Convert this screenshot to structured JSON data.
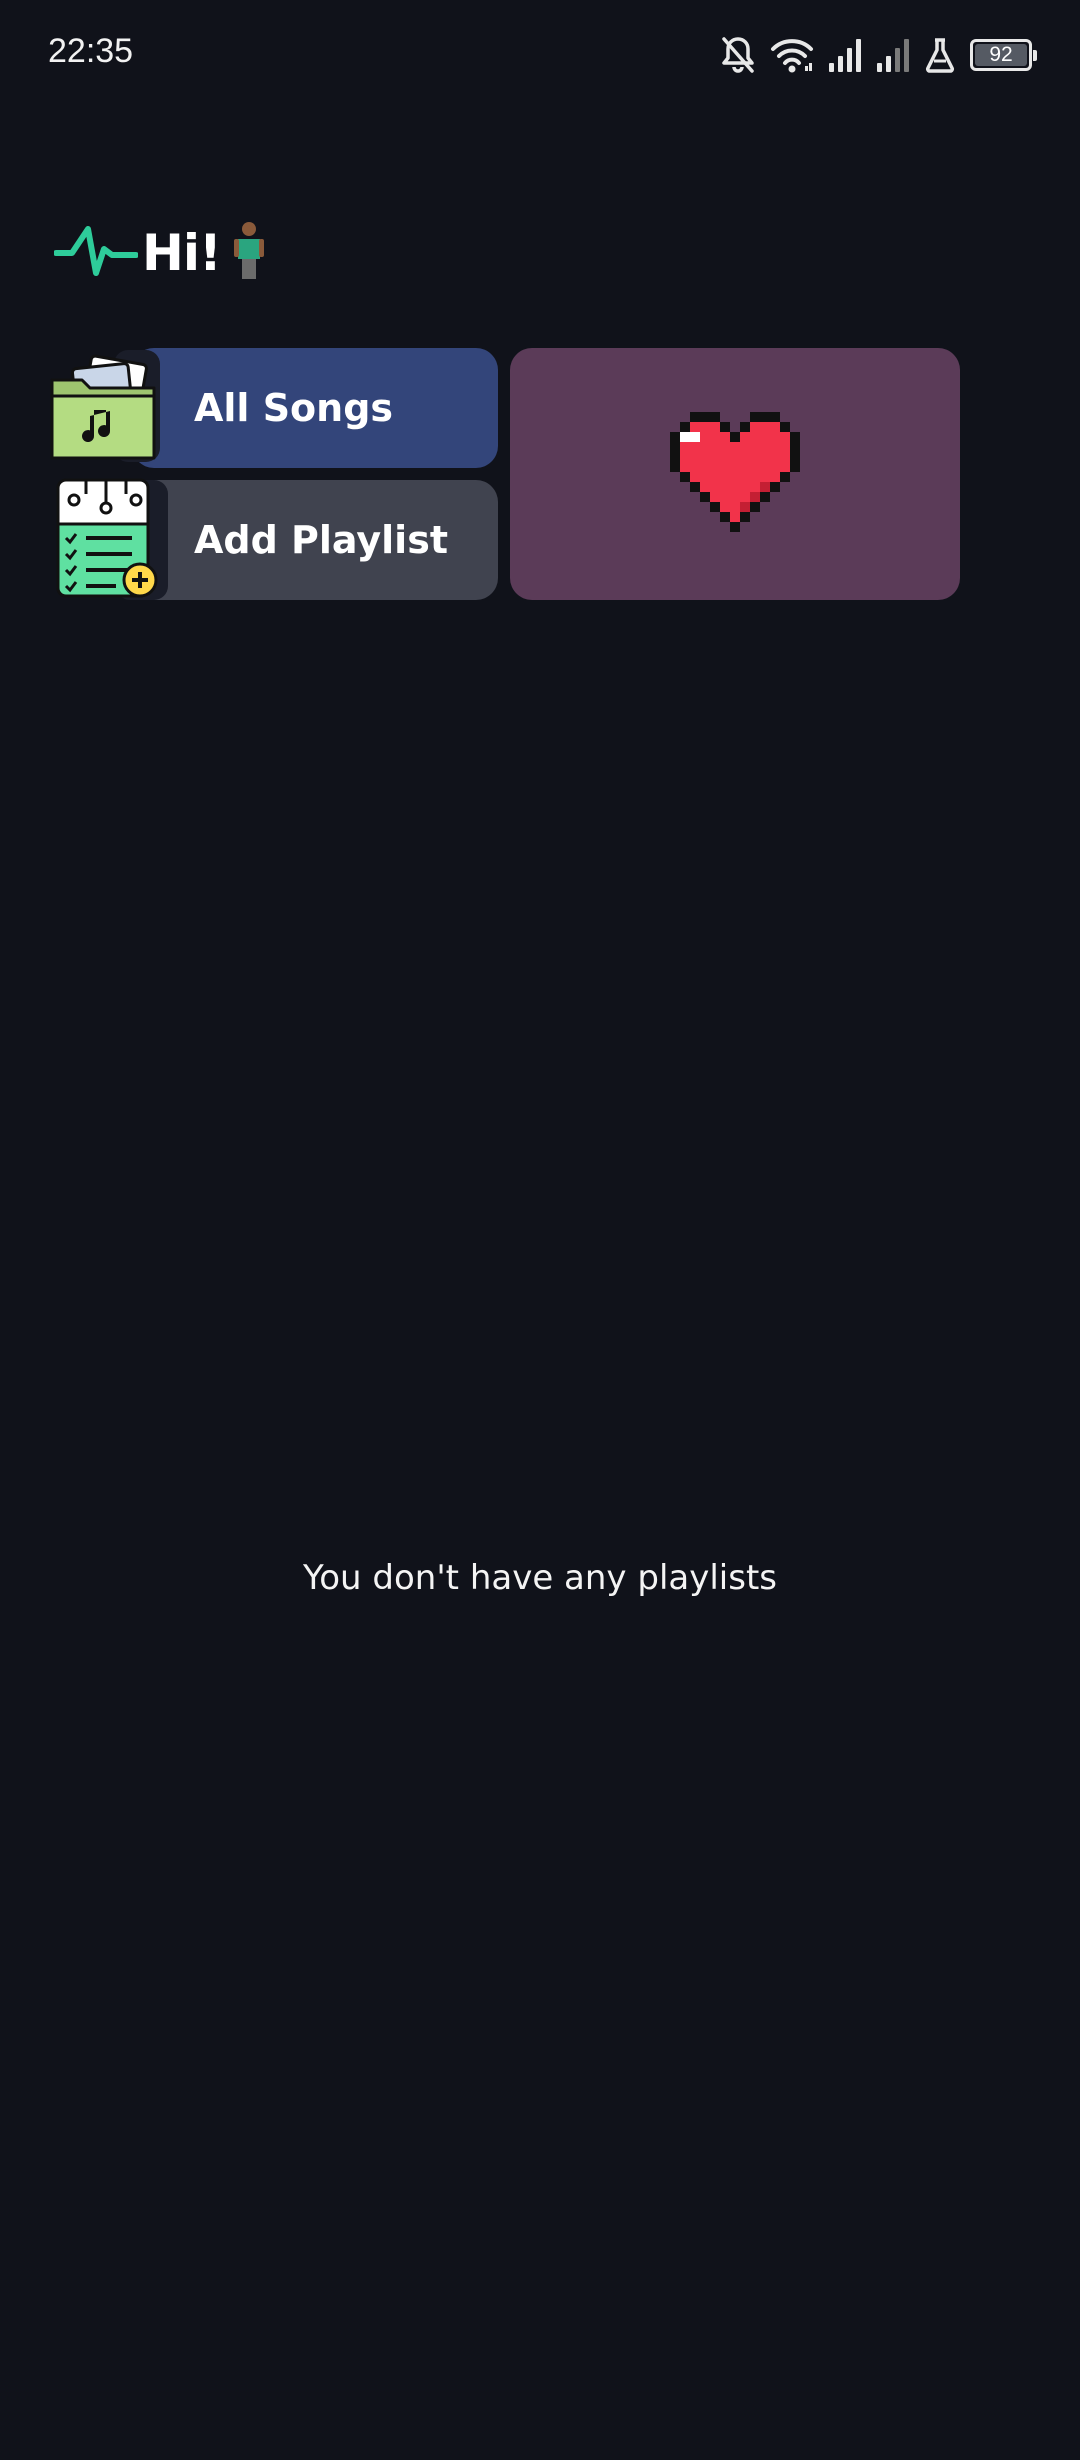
{
  "status_bar": {
    "time": "22:35",
    "battery_level": "92",
    "icons": [
      "bell-off-icon",
      "wifi-icon",
      "signal-icon",
      "signal-weak-icon",
      "lab-flask-icon",
      "battery-icon"
    ]
  },
  "header": {
    "greeting": "Hi!",
    "logo_icon": "pulse-icon",
    "emoji_icon": "person-standing-icon"
  },
  "cards": {
    "all_songs": {
      "label": "All Songs",
      "icon": "music-folder-icon",
      "color": "#33457a"
    },
    "add_playlist": {
      "label": "Add Playlist",
      "icon": "playlist-add-icon",
      "color": "#40434f"
    },
    "favorites": {
      "icon": "pixel-heart-icon",
      "color": "#5b3b58"
    }
  },
  "empty_state": {
    "message": "You don't have any playlists"
  },
  "colors": {
    "background": "#10121a",
    "accent": "#2ecc9a",
    "heart": "#f2334a"
  }
}
